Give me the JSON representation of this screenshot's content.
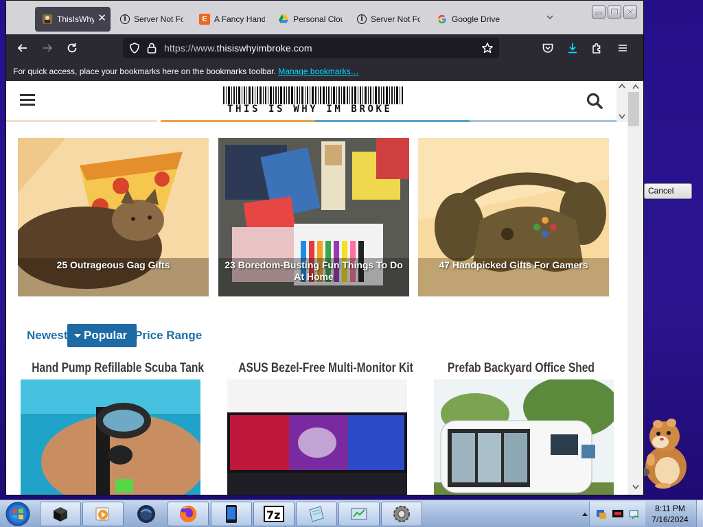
{
  "browser": {
    "tabs": [
      {
        "label": "ThisIsWhyImBroke",
        "icon": "site-favicon-icon",
        "active": true
      },
      {
        "label": "Server Not Found",
        "icon": "info-icon"
      },
      {
        "label": "A Fancy Handmade",
        "icon": "etsy-icon"
      },
      {
        "label": "Personal Cloud Storage",
        "icon": "google-drive-icon"
      },
      {
        "label": "Server Not Found",
        "icon": "info-icon"
      },
      {
        "label": "Google Drive",
        "icon": "google-icon"
      }
    ],
    "url": {
      "scheme": "https://www.",
      "host": "thisiswhyimbroke.com"
    },
    "bookmarks_bar": {
      "message": "For quick access, place your bookmarks here on the bookmarks toolbar.",
      "link": "Manage bookmarks…"
    }
  },
  "site": {
    "logo_text": "THIS IS WHY IM BROKE",
    "features": [
      {
        "title": "25 Outrageous Gag Gifts"
      },
      {
        "title": "23 Boredom-Busting Fun Things To Do At Home"
      },
      {
        "title": "47 Handpicked Gifts For Gamers"
      }
    ],
    "filters": [
      {
        "label": "Newest"
      },
      {
        "label": "Popular",
        "active": true
      },
      {
        "label": "Price Range"
      }
    ],
    "products": [
      {
        "title": "Hand Pump Refillable Scuba Tank"
      },
      {
        "title": "ASUS Bezel-Free Multi-Monitor Kit"
      },
      {
        "title": "Prefab Backyard Office Shed"
      }
    ]
  },
  "desktop": {
    "cancel_button": "Cancel"
  },
  "taskbar": {
    "time": "8:11 PM",
    "date": "7/16/2024"
  },
  "colors": {
    "accent_blue": "#1e6aa4",
    "link_cyan": "#00ddff",
    "desktop": "#2a0f86"
  }
}
